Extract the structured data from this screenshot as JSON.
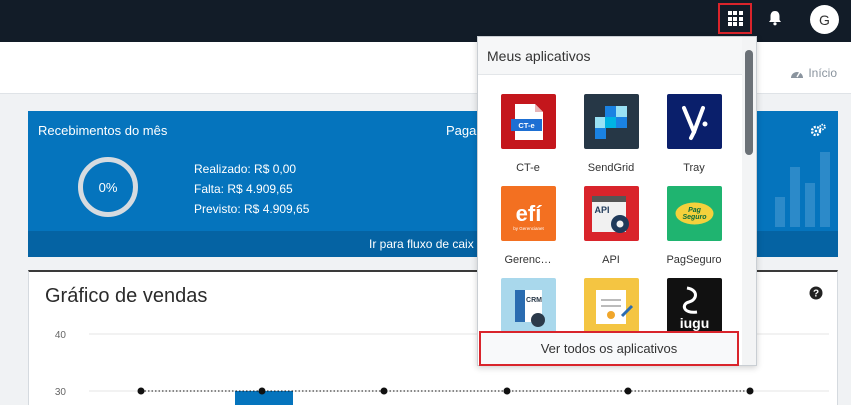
{
  "topbar": {
    "avatar_initial": "G",
    "icons": [
      "apps-grid-icon",
      "bell-icon"
    ]
  },
  "breadcrumb": {
    "label": "Início",
    "icon": "dashboard-icon"
  },
  "receivables": {
    "title": "Recebimentos do mês",
    "second_title": "Paga",
    "progress": "0%",
    "progress_value": 0,
    "realizado": "Realizado: R$ 0,00",
    "falta": "Falta: R$ 4.909,65",
    "previsto": "Previsto: R$ 4.909,65",
    "footer_link": "Ir para fluxo de caix",
    "icon": "gears-icon"
  },
  "chart_card": {
    "title": "Gráfico de vendas",
    "help_icon": "question-icon"
  },
  "chart_data": {
    "type": "bar",
    "y_ticks": [
      "40",
      "30"
    ],
    "ylim": [
      0,
      40
    ],
    "title": "Gráfico de vendas",
    "series": [
      {
        "values": [
          30,
          30,
          30,
          30,
          30,
          30
        ]
      }
    ]
  },
  "apps_menu": {
    "title": "Meus aplicativos",
    "see_all": "Ver todos os aplicativos",
    "apps": [
      {
        "label": "CT-e",
        "icon": "cte-icon",
        "color": "#c4161c"
      },
      {
        "label": "SendGrid",
        "icon": "sendgrid-icon",
        "color": "#263746"
      },
      {
        "label": "Tray",
        "icon": "tray-icon",
        "color": "#0a1f6b"
      },
      {
        "label": "Gerenc…",
        "icon": "efi-icon",
        "color": "#f37021"
      },
      {
        "label": "API",
        "icon": "api-icon",
        "color": "#d9242b"
      },
      {
        "label": "PagSeguro",
        "icon": "pagseguro-icon",
        "color": "#1fb470"
      },
      {
        "label": "",
        "icon": "crm-icon",
        "color": "#a9d8ec"
      },
      {
        "label": "",
        "icon": "certificate-icon",
        "color": "#f4c542"
      },
      {
        "label": "",
        "icon": "iugu-icon",
        "color": "#111111"
      }
    ]
  }
}
